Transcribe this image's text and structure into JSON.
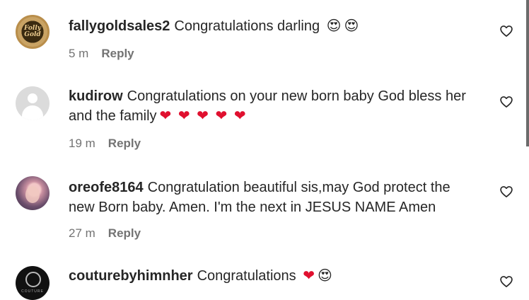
{
  "comments": [
    {
      "username": "fallygoldsales2",
      "text": "Congratulations darling",
      "emojis": [
        "😍",
        "😍"
      ],
      "time": "5 m",
      "reply_label": "Reply",
      "avatar_text": "Folly Gold"
    },
    {
      "username": "kudirow",
      "text": "Congratulations on your new born baby God bless her and the family",
      "emojis": [
        "❤",
        "❤",
        "❤",
        "❤",
        "❤"
      ],
      "time": "19 m",
      "reply_label": "Reply",
      "avatar_text": ""
    },
    {
      "username": "oreofe8164",
      "text": "Congratulation beautiful sis,may God protect the new Born baby. Amen. I'm the next in JESUS NAME Amen",
      "emojis": [],
      "time": "27 m",
      "reply_label": "Reply",
      "avatar_text": ""
    },
    {
      "username": "couturebyhimnher",
      "text": "Congratulations",
      "emojis": [
        "❤",
        "😍"
      ],
      "time": "",
      "reply_label": "",
      "avatar_text": "COUTURE"
    }
  ],
  "icons": {
    "like": "heart-outline-icon"
  },
  "colors": {
    "text": "#262626",
    "meta": "#737373",
    "heart": "#e0102f"
  }
}
